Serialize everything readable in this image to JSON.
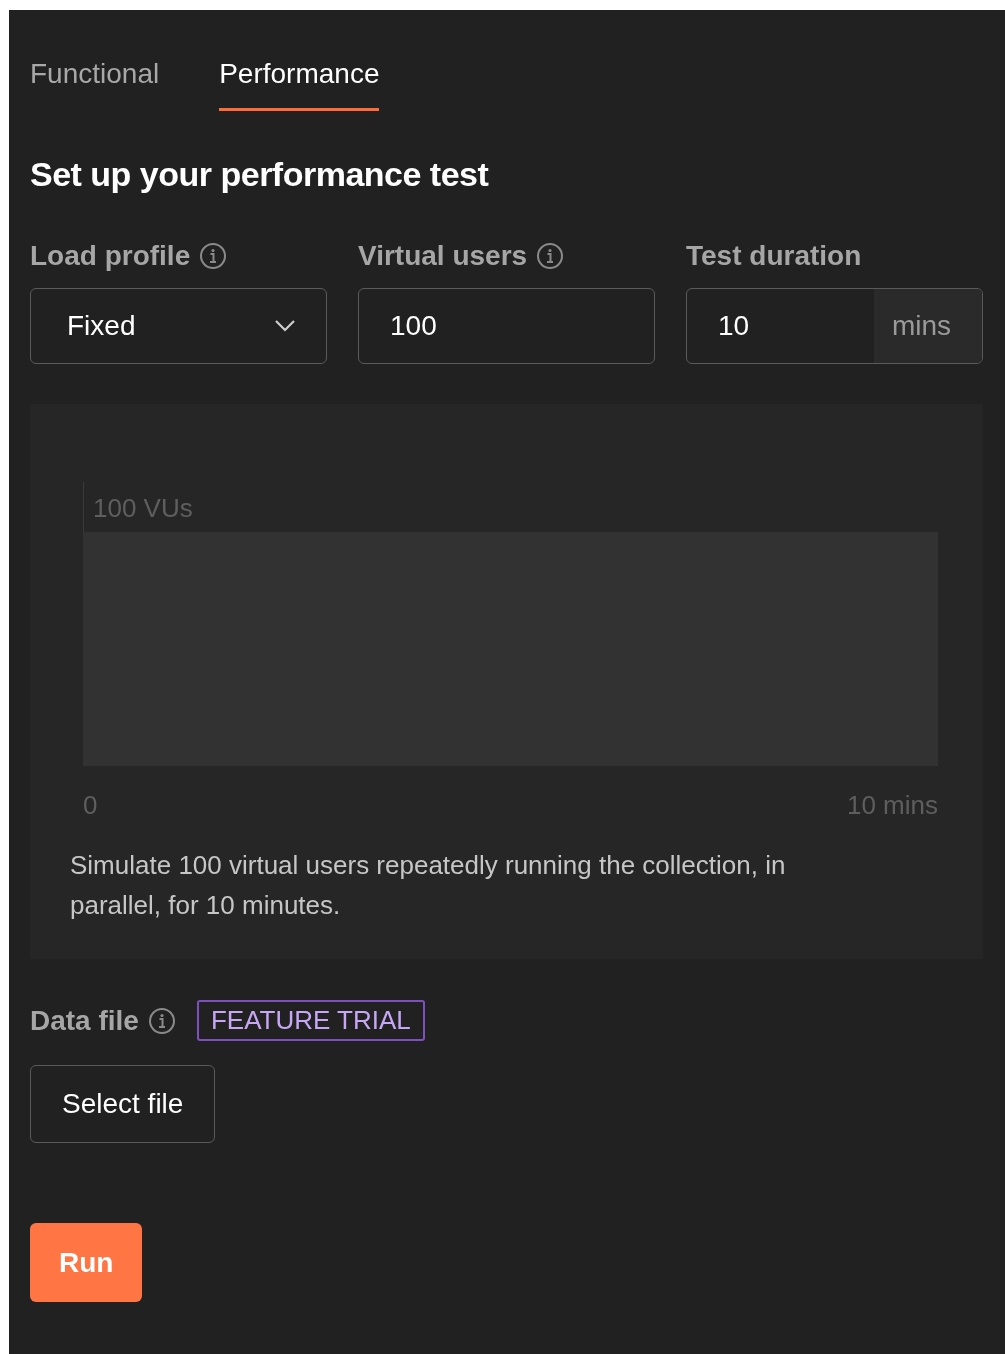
{
  "tabs": [
    {
      "label": "Functional",
      "selected": false
    },
    {
      "label": "Performance",
      "selected": true
    }
  ],
  "heading": "Set up your performance test",
  "fields": [
    {
      "kind": "dropdown",
      "label": "Load profile",
      "info": true,
      "value": "Fixed"
    },
    {
      "kind": "text",
      "label": "Virtual users",
      "info": true,
      "value": "100"
    },
    {
      "kind": "unit",
      "label": "Test duration",
      "info": false,
      "value": "10",
      "unit": "mins"
    }
  ],
  "chart": {
    "y_label": "100 VUs",
    "x_start": "0",
    "x_end": "10 mins",
    "description": "Simulate 100 virtual users repeatedly running the collection, in parallel, for 10 minutes."
  },
  "data_file": {
    "label": "Data file",
    "info": true,
    "badge": "FEATURE TRIAL",
    "button": "Select file"
  },
  "run_button": "Run"
}
